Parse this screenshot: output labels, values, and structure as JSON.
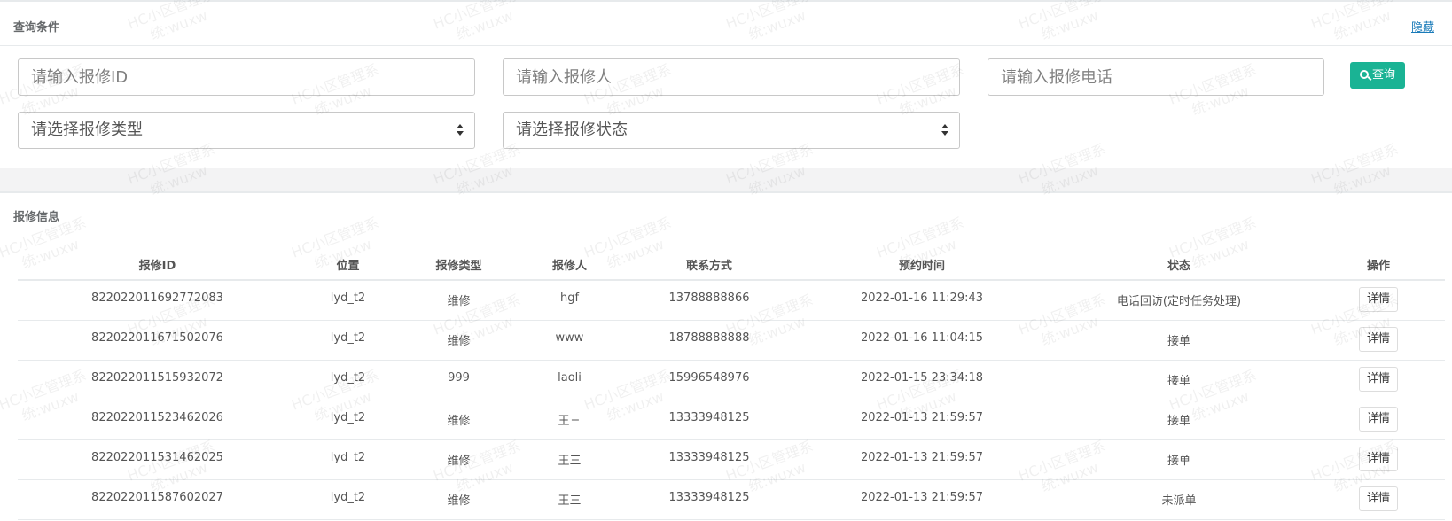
{
  "search_panel": {
    "title": "查询条件",
    "hide_link": "隐藏",
    "repair_id_placeholder": "请输入报修ID",
    "repair_person_placeholder": "请输入报修人",
    "repair_phone_placeholder": "请输入报修电话",
    "repair_type_select": "请选择报修类型",
    "repair_state_select": "请选择报修状态",
    "query_button": "查询"
  },
  "table_panel": {
    "title": "报修信息",
    "columns": [
      "报修ID",
      "位置",
      "报修类型",
      "报修人",
      "联系方式",
      "预约时间",
      "状态",
      "操作"
    ],
    "rows": [
      {
        "id": "822022011692772083",
        "location": "lyd_t2",
        "type": "维修",
        "person": "hgf",
        "phone": "13788888866",
        "time": "2022-01-16 11:29:43",
        "state": "电话回访(定时任务处理)",
        "action": "详情"
      },
      {
        "id": "822022011671502076",
        "location": "lyd_t2",
        "type": "维修",
        "person": "www",
        "phone": "18788888888",
        "time": "2022-01-16 11:04:15",
        "state": "接单",
        "action": "详情"
      },
      {
        "id": "822022011515932072",
        "location": "lyd_t2",
        "type": "999",
        "person": "laoli",
        "phone": "15996548976",
        "time": "2022-01-15 23:34:18",
        "state": "接单",
        "action": "详情"
      },
      {
        "id": "822022011523462026",
        "location": "lyd_t2",
        "type": "维修",
        "person": "王三",
        "phone": "13333948125",
        "time": "2022-01-13 21:59:57",
        "state": "接单",
        "action": "详情"
      },
      {
        "id": "822022011531462025",
        "location": "lyd_t2",
        "type": "维修",
        "person": "王三",
        "phone": "13333948125",
        "time": "2022-01-13 21:59:57",
        "state": "接单",
        "action": "详情"
      },
      {
        "id": "822022011587602027",
        "location": "lyd_t2",
        "type": "维修",
        "person": "王三",
        "phone": "13333948125",
        "time": "2022-01-13 21:59:57",
        "state": "未派单",
        "action": "详情"
      }
    ]
  },
  "watermark": {
    "line1": "HC小区管理系",
    "line2": "统:wuxw"
  },
  "colors": {
    "accent": "#1ab394",
    "link": "#1a7bb9",
    "border": "#e7eaec",
    "background": "#f3f3f4"
  }
}
